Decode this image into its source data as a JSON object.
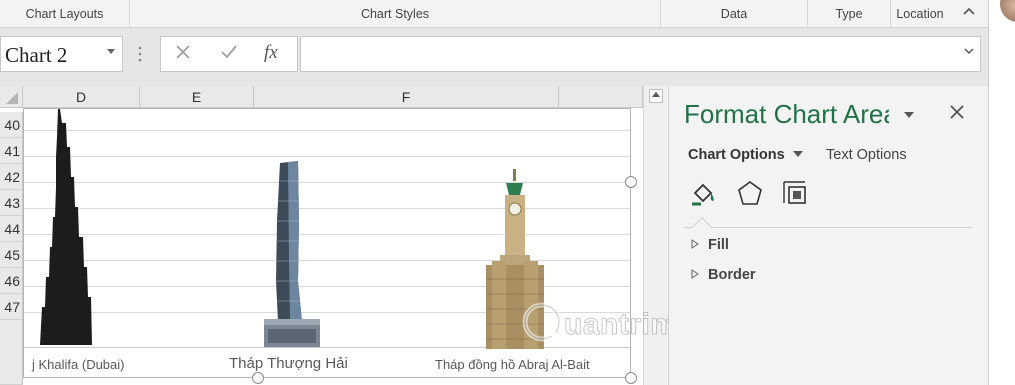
{
  "ribbon": {
    "groups": [
      "Chart Layouts",
      "Chart Styles",
      "Data",
      "Type",
      "Location"
    ],
    "collapse_icon": "chevron-up-icon"
  },
  "formula_bar": {
    "name_box": "Chart 2",
    "cancel_icon": "x-icon",
    "enter_icon": "check-icon",
    "function_label": "fx",
    "formula": ""
  },
  "grid": {
    "columns": [
      "D",
      "E",
      "F"
    ],
    "rows": [
      "40",
      "41",
      "42",
      "43",
      "44",
      "45",
      "46",
      "47"
    ]
  },
  "chart": {
    "categories": [
      "j Khalifa (Dubai)",
      "Tháp Thượng Hải",
      "Tháp đồng hồ Abraj Al-Bait"
    ]
  },
  "pane": {
    "title": "Format Chart Area",
    "tab_active": "Chart Options",
    "tab_inactive": "Text Options",
    "icons": [
      "fill-bucket-icon",
      "pentagon-icon",
      "size-properties-icon"
    ],
    "sections": [
      "Fill",
      "Border"
    ]
  },
  "watermark": {
    "text": "uantrimang"
  },
  "colors": {
    "accent": "#217346",
    "pane_bg": "#f3f3f3"
  }
}
